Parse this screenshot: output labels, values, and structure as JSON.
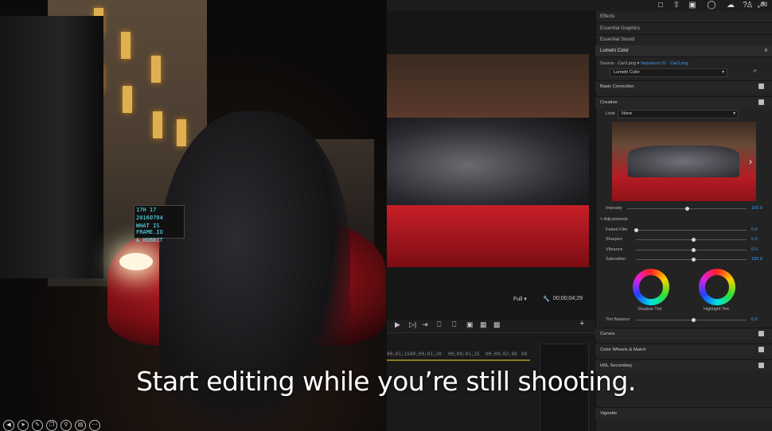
{
  "caption": "Start editing while you’re still shooting.",
  "film_set": {
    "slate_lines": [
      "17H 17",
      "20160704",
      "WHAT IS FRAME.IO",
      "& HOBBIT"
    ]
  },
  "panel_tabs": [
    "Effects",
    "Essential Graphics",
    "Essential Sound",
    "Lumetri Color"
  ],
  "lumetri": {
    "source_label": "Source · Car2.png",
    "sequence_label": "Sequence 01 · Car2.png",
    "preset": "Lumetri Color",
    "basic_correction": "Basic Correction",
    "creative": "Creative",
    "look_label": "Look",
    "look_value": "None",
    "intensity_label": "Intensity",
    "intensity_value": "100.0",
    "intensity": 100,
    "adjustments": "Adjustments",
    "sliders": [
      {
        "label": "Faded Film",
        "value": "0.0"
      },
      {
        "label": "Sharpen",
        "value": "0.0"
      },
      {
        "label": "Vibrance",
        "value": "0.0"
      },
      {
        "label": "Saturation",
        "value": "100.0"
      }
    ],
    "shadow_tint": "Shadow Tint",
    "highlight_tint": "Highlight Tint",
    "tint_balance_label": "Tint Balance",
    "tint_balance_value": "0.0",
    "sections": [
      "Curves",
      "Color Wheels & Match",
      "HSL Secondary",
      "Vignette"
    ]
  },
  "monitor": {
    "zoom": "Full",
    "timecode": "00;00;04;29"
  },
  "timeline": {
    "ticks": [
      "00;01;15",
      "00;00;01;20",
      "00;00;01;25",
      "00;00;02;00",
      "00"
    ]
  },
  "colors": {
    "accent_blue": "#3d9df5",
    "panel_bg": "#232323"
  }
}
